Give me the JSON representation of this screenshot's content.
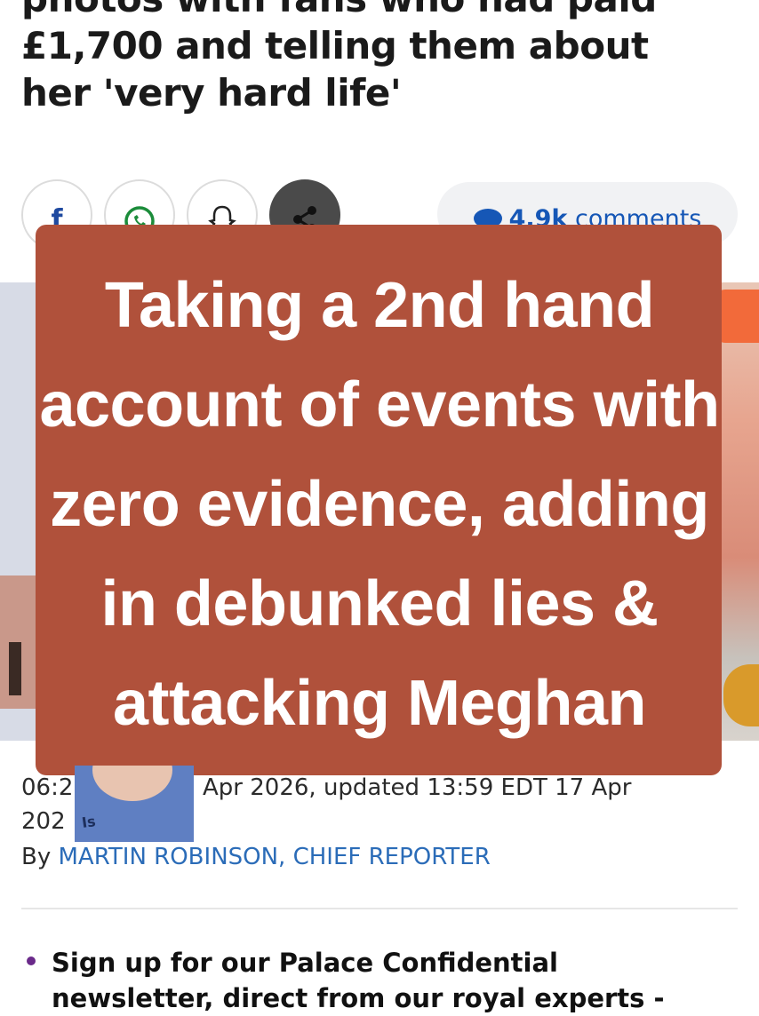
{
  "headline": {
    "lines": [
      "photos with fans who had paid",
      "£1,700 and telling them about",
      "her 'very hard life'"
    ]
  },
  "share": {
    "buttons": [
      {
        "name": "facebook-icon",
        "label": "f"
      },
      {
        "name": "whatsapp-icon"
      },
      {
        "name": "snapchat-icon"
      },
      {
        "name": "share-icon"
      }
    ],
    "comments_count": "4.9k",
    "comments_label": "comments"
  },
  "caption": {
    "lines": [
      "Taking a 2nd hand",
      "account of events with",
      "zero evidence, adding",
      "in debunked lies &",
      "attacking Meghan"
    ]
  },
  "article_meta": {
    "date_start": "06:2",
    "date_end": "Apr 2026, updated 13:59 EDT 17 Apr",
    "date_line2": "202",
    "avatar_text": "Is"
  },
  "byline": {
    "prefix": "By",
    "author": "MARTIN ROBINSON, CHIEF REPORTER"
  },
  "bullets": [
    {
      "lines": [
        "Sign up for our Palace Confidential",
        "newsletter, direct from our royal experts -"
      ]
    }
  ],
  "colors": {
    "overlay": "#b0513b",
    "link": "#2b6cb8",
    "comments": "#1657b6"
  }
}
